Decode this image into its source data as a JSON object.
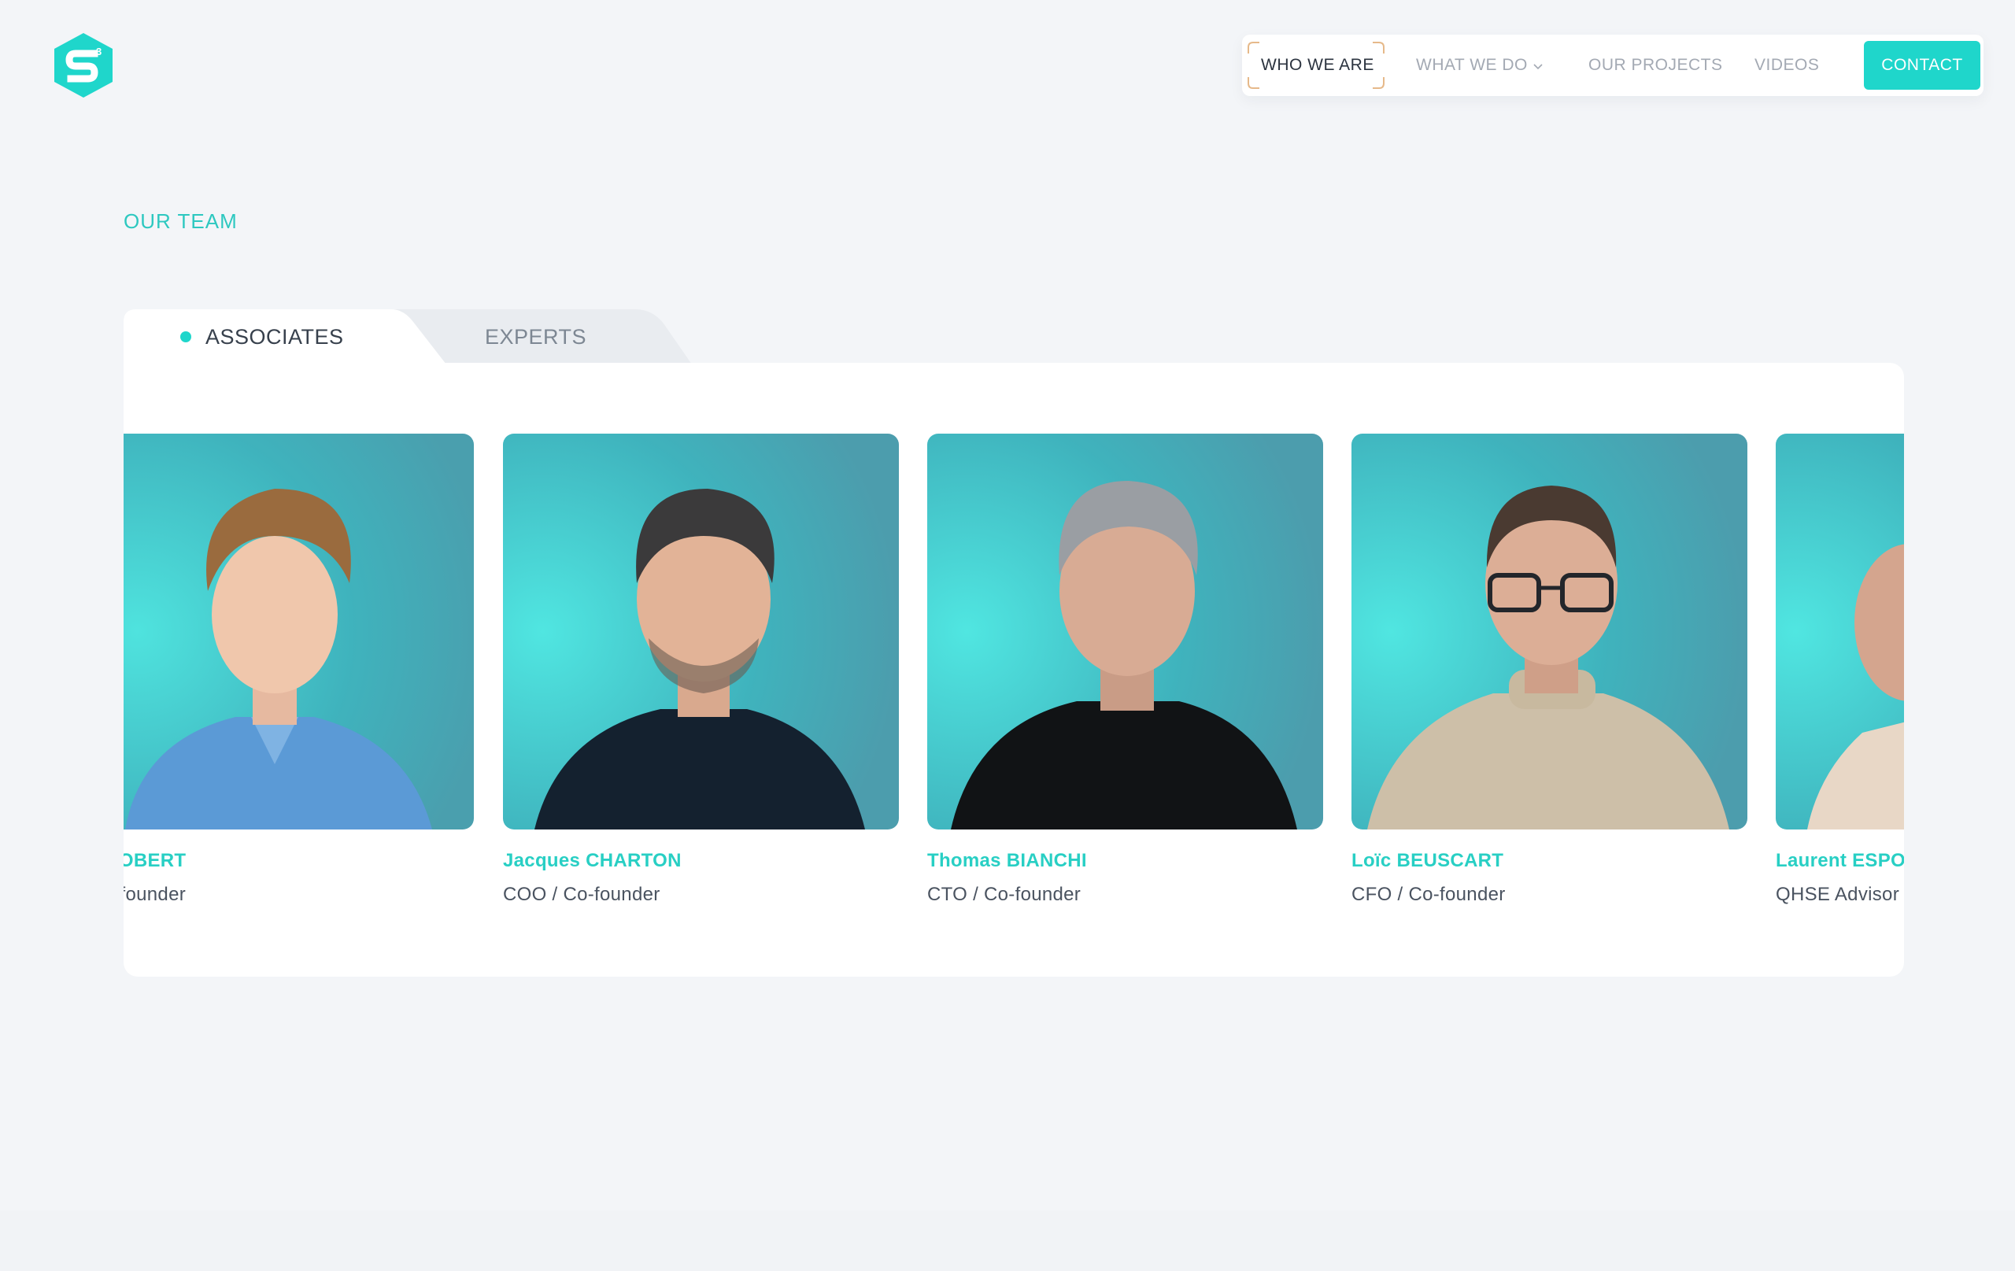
{
  "brand": {
    "logo_icon": "s3-hexagon-logo-icon",
    "accent": "#1fd6cb"
  },
  "nav": {
    "items": [
      {
        "label": "WHO WE ARE",
        "active": true
      },
      {
        "label": "WHAT WE DO",
        "dropdown": true,
        "icon": "chevron-down-icon"
      },
      {
        "label": "OUR PROJECTS"
      },
      {
        "label": "VIDEOS"
      }
    ],
    "contact_label": "CONTACT"
  },
  "section": {
    "title": "OUR TEAM"
  },
  "tabs": [
    {
      "label": "ASSOCIATES",
      "active": true
    },
    {
      "label": "EXPERTS",
      "active": false
    }
  ],
  "team": [
    {
      "name": "ck ROBERT",
      "role": "/ Co-founder"
    },
    {
      "name": "Jacques CHARTON",
      "role": "COO / Co-founder"
    },
    {
      "name": "Thomas BIANCHI",
      "role": "CTO / Co-founder"
    },
    {
      "name": "Loïc BEUSCART",
      "role": "CFO / Co-founder"
    },
    {
      "name": "Laurent ESPO",
      "role": "QHSE Advisor"
    }
  ]
}
